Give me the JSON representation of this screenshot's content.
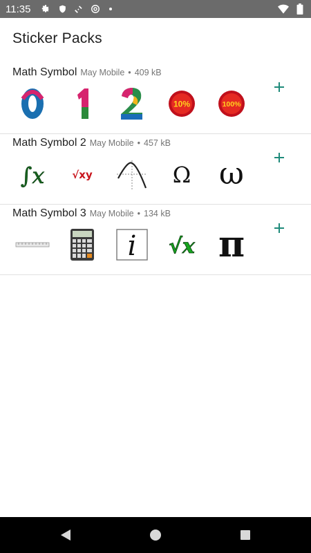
{
  "status_bar": {
    "time": "11:35",
    "icons": [
      "gear-icon",
      "shield-icon",
      "satellite-icon",
      "at-icon",
      "dot-icon"
    ],
    "right_icons": [
      "wifi-icon",
      "battery-icon"
    ]
  },
  "header": {
    "title": "Sticker Packs"
  },
  "colors": {
    "accent": "#1e8a7a",
    "divider": "#e0e0e0"
  },
  "packs": [
    {
      "name": "Math Symbol",
      "publisher": "May Mobile",
      "separator": "•",
      "size": "409 kB",
      "stickers": [
        {
          "icon": "digit-0-sticker",
          "text": "0"
        },
        {
          "icon": "digit-1-sticker",
          "text": "1"
        },
        {
          "icon": "digit-2-sticker",
          "text": "2"
        },
        {
          "icon": "percent-10-sticker",
          "text": "10%"
        },
        {
          "icon": "percent-100-sticker",
          "text": "100%"
        }
      ]
    },
    {
      "name": "Math Symbol 2",
      "publisher": "May Mobile",
      "separator": "•",
      "size": "457 kB",
      "stickers": [
        {
          "icon": "integral-x-sticker",
          "text": "∫x"
        },
        {
          "icon": "sqrt-xy-sticker",
          "text": "√xy"
        },
        {
          "icon": "curve-graph-sticker",
          "text": ""
        },
        {
          "icon": "omega-upper-sticker",
          "text": "Ω"
        },
        {
          "icon": "omega-lower-sticker",
          "text": "ω"
        }
      ]
    },
    {
      "name": "Math Symbol 3",
      "publisher": "May Mobile",
      "separator": "•",
      "size": "134 kB",
      "stickers": [
        {
          "icon": "ruler-sticker",
          "text": ""
        },
        {
          "icon": "calculator-sticker",
          "text": ""
        },
        {
          "icon": "italic-i-sticker",
          "text": "i"
        },
        {
          "icon": "sqrt-x-sticker",
          "text": "√x"
        },
        {
          "icon": "pi-sticker",
          "text": "π"
        }
      ]
    }
  ],
  "nav": {
    "buttons": [
      "back-icon",
      "home-icon",
      "recents-icon"
    ]
  }
}
